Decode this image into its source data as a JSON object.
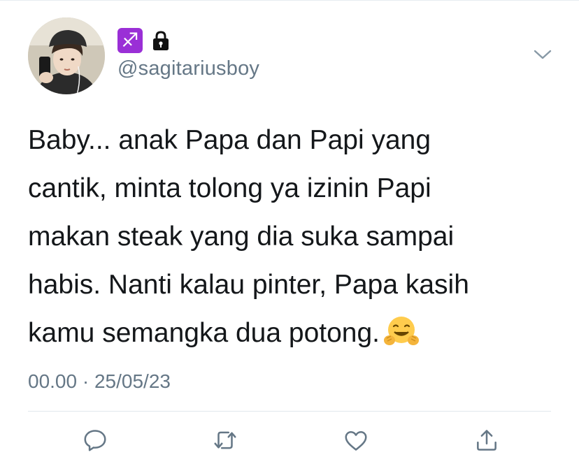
{
  "user": {
    "avatar_icon": "avatar-photo",
    "zodiac_glyph": "♐",
    "zodiac_color": "#9a2fd6",
    "lock_icon": "lock-icon",
    "handle": "@sagitariusboy"
  },
  "header": {
    "menu_icon": "chevron-down-icon"
  },
  "tweet": {
    "text": "Baby... anak Papa dan Papi yang\ncantik, minta tolong ya izinin Papi\nmakan steak yang dia suka sampai\nhabis. Nanti kalau pinter, Papa kasih\nkamu semangka dua potong.",
    "emoji_icon": "hugging-face-emoji"
  },
  "meta": {
    "time": "00.00",
    "separator": "·",
    "date": "25/05/23"
  },
  "actions": {
    "icons": [
      "reply-icon",
      "retweet-icon",
      "like-icon",
      "share-icon"
    ],
    "color": "#657786"
  }
}
